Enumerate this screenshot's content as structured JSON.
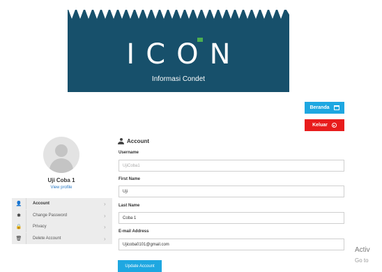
{
  "banner": {
    "logo_text": "ICON",
    "subtitle": "Informasi Condet",
    "colors": {
      "background": "#17506b",
      "accent_dot": "#4caf50"
    }
  },
  "header": {
    "home_label": "Beranda",
    "home_icon": "home-icon",
    "logout_label": "Keluar",
    "logout_icon": "power-icon",
    "colors": {
      "home": "#1ea7e1",
      "logout": "#e81c1c"
    }
  },
  "profile": {
    "name": "Uji Coba 1",
    "view_link": "View profile"
  },
  "menu": {
    "items": [
      {
        "label": "Account",
        "icon": "user-icon"
      },
      {
        "label": "Change Password",
        "icon": "asterisk-icon"
      },
      {
        "label": "Privacy",
        "icon": "lock-icon"
      },
      {
        "label": "Delete Account",
        "icon": "trash-icon"
      }
    ]
  },
  "form": {
    "title": "Account",
    "username": {
      "label": "Username",
      "value": "UjiCoba1"
    },
    "first_name": {
      "label": "First Name",
      "value": "Uji"
    },
    "last_name": {
      "label": "Last Name",
      "value": "Coba 1"
    },
    "email": {
      "label": "E-mail Address",
      "value": "Ujicoba0101@gmail.com"
    },
    "submit_label": "Update Account"
  },
  "watermark": {
    "line1": "Activ",
    "line2": "Go to"
  }
}
